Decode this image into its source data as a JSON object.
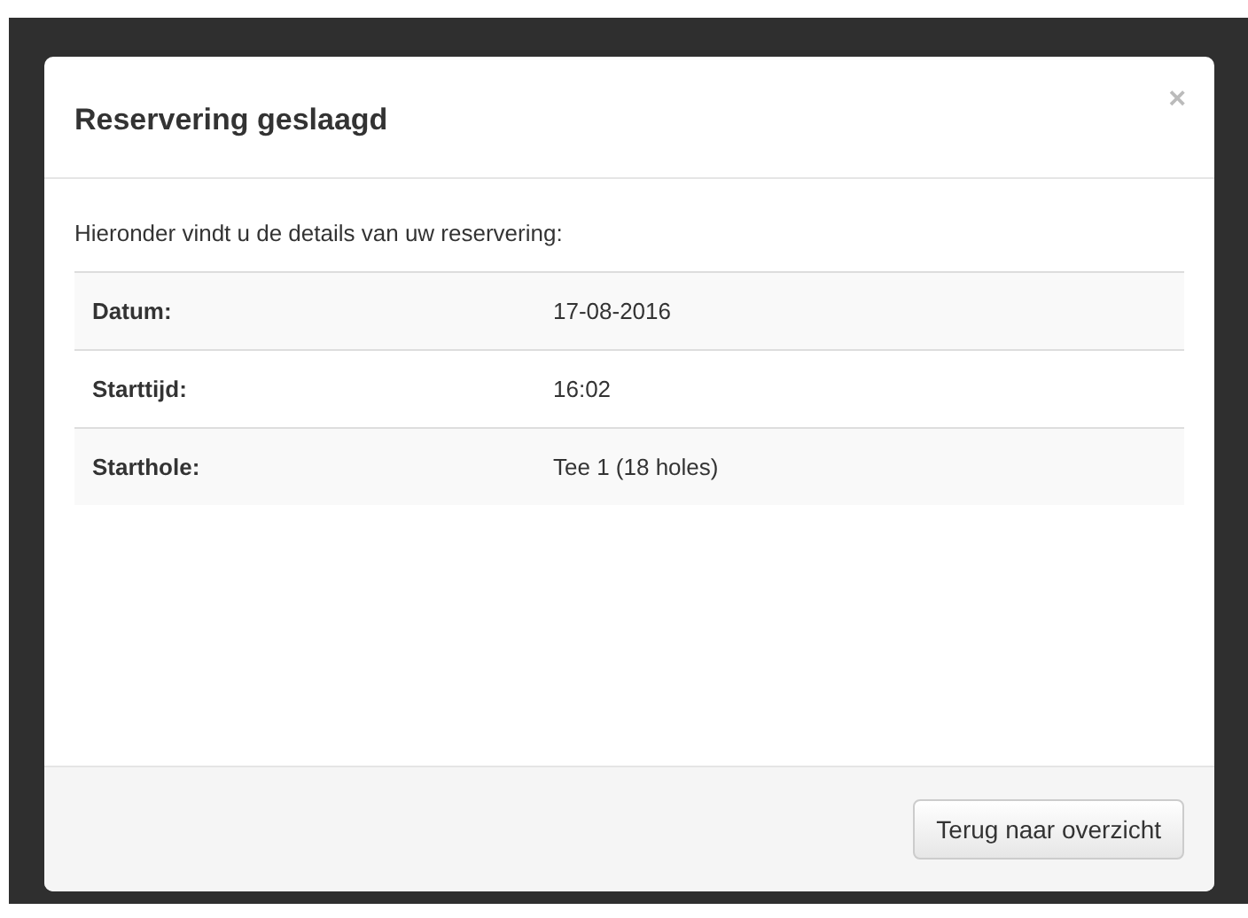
{
  "modal": {
    "title": "Reservering geslaagd",
    "close": "×",
    "intro": "Hieronder vindt u de details van uw reservering:",
    "details": [
      {
        "label": "Datum:",
        "value": "17-08-2016"
      },
      {
        "label": "Starttijd:",
        "value": "16:02"
      },
      {
        "label": "Starthole:",
        "value": "Tee 1 (18 holes)"
      }
    ],
    "button": "Terug naar overzicht"
  }
}
